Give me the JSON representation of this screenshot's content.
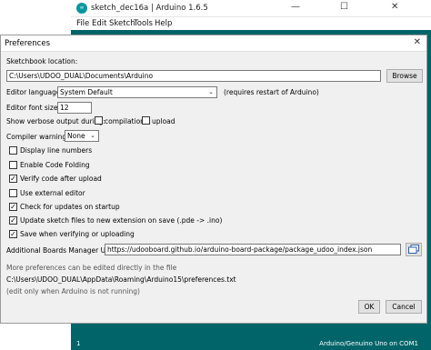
{
  "ide": {
    "window_title": "sketch_dec16a | Arduino 1.6.5",
    "menu": [
      "File",
      "Edit",
      "Sketch",
      "Tools",
      "Help"
    ],
    "status_left": "1",
    "status_right": "Arduino/Genuino Uno on COM1",
    "minimize_glyph": "—",
    "maximize_glyph": "☐",
    "close_glyph": "✕"
  },
  "prefs": {
    "title": "Preferences",
    "close_glyph": "✕",
    "sketchbook_label": "Sketchbook location:",
    "sketchbook_value": "C:\\Users\\UDOO_DUAL\\Documents\\Arduino",
    "browse_label": "Browse",
    "editor_language_label": "Editor language:",
    "editor_language_value": "System Default",
    "requires_restart": "(requires restart of Arduino)",
    "font_size_label": "Editor font size:",
    "font_size_value": "12",
    "verbose_label": "Show verbose output during:",
    "compilation_label": "compilation",
    "upload_label": "upload",
    "compiler_warnings_label": "Compiler warnings:",
    "compiler_warnings_value": "None",
    "checkboxes": [
      {
        "label": "Display line numbers",
        "checked": false
      },
      {
        "label": "Enable Code Folding",
        "checked": false
      },
      {
        "label": "Verify code after upload",
        "checked": true
      },
      {
        "label": "Use external editor",
        "checked": false
      },
      {
        "label": "Check for updates on startup",
        "checked": true
      },
      {
        "label": "Update sketch files to new extension on save (.pde -> .ino)",
        "checked": true
      },
      {
        "label": "Save when verifying or uploading",
        "checked": true
      }
    ],
    "boards_label": "Additional Boards Manager URLs:",
    "boards_value": "https://udooboard.github.io/arduino-board-package/package_udoo_index.json",
    "more_prefs_note": "More preferences can be edited directly in the file",
    "prefs_path": "C:\\Users\\UDOO_DUAL\\AppData\\Roaming\\Arduino15\\preferences.txt",
    "edit_note": "(edit only when Arduino is not running)",
    "ok_label": "OK",
    "cancel_label": "Cancel",
    "check_glyph": "✓",
    "dropdown_glyph": "⌄"
  }
}
